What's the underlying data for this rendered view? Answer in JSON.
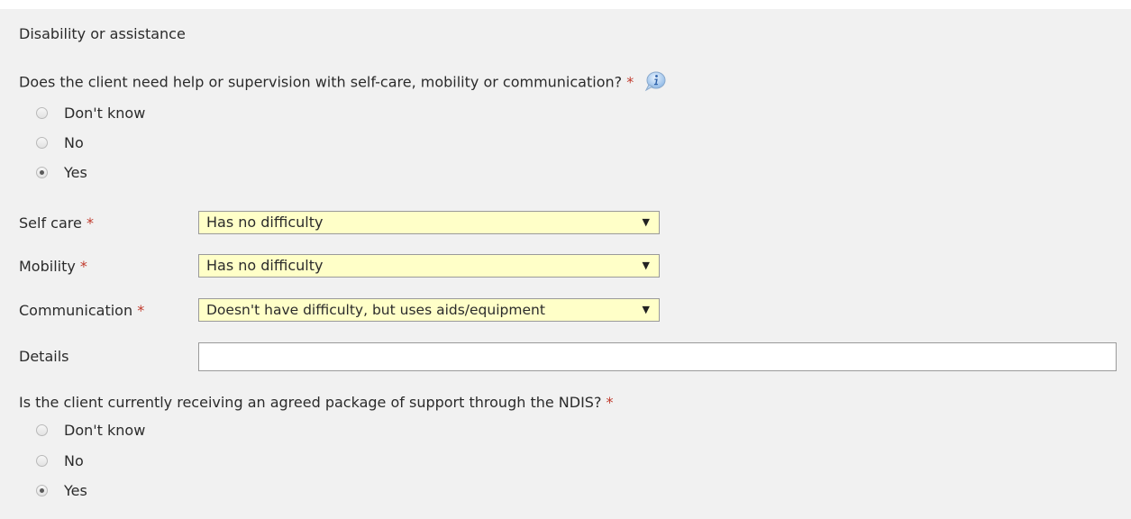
{
  "section": {
    "title": "Disability or assistance"
  },
  "q1": {
    "text": "Does the client need help or supervision with self-care, mobility or communication?",
    "required_mark": "*",
    "info_icon": "info-icon",
    "options": [
      {
        "label": "Don't know",
        "checked": false
      },
      {
        "label": "No",
        "checked": false
      },
      {
        "label": "Yes",
        "checked": true
      }
    ]
  },
  "fields": {
    "self_care": {
      "label": "Self care",
      "required_mark": "*",
      "value": "Has no difficulty"
    },
    "mobility": {
      "label": "Mobility",
      "required_mark": "*",
      "value": "Has no difficulty"
    },
    "communication": {
      "label": "Communication",
      "required_mark": "*",
      "value": "Doesn't have difficulty, but uses aids/equipment"
    },
    "details": {
      "label": "Details",
      "value": ""
    }
  },
  "q2": {
    "text": "Is the client currently receiving an agreed package of support through the NDIS?",
    "required_mark": "*",
    "options": [
      {
        "label": "Don't know",
        "checked": false
      },
      {
        "label": "No",
        "checked": false
      },
      {
        "label": "Yes",
        "checked": true
      }
    ]
  },
  "select_arrow_glyph": "▼",
  "colors": {
    "panel_bg": "#f1f1f1",
    "required": "#c0392b",
    "select_bg": "#ffffc8"
  }
}
